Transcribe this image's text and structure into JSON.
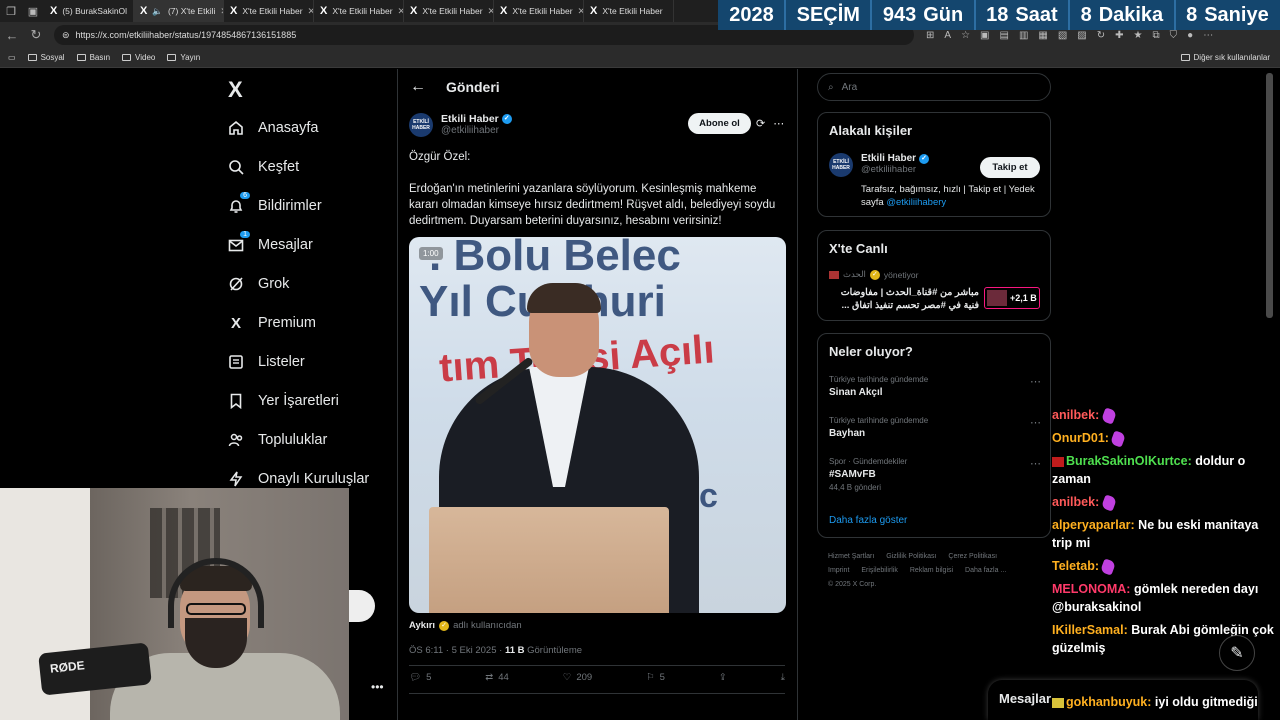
{
  "browser": {
    "tabs": [
      {
        "label": "",
        "active": false
      },
      {
        "label": "(5) BurakSakinOl",
        "active": false
      },
      {
        "label": "(7) X'te Etkili",
        "active": true
      },
      {
        "label": "X'te Etkili Haber",
        "active": false
      },
      {
        "label": "X'te Etkili Haber",
        "active": false
      },
      {
        "label": "X'te Etkili Haber",
        "active": false
      },
      {
        "label": "X'te Etkili Haber",
        "active": false
      },
      {
        "label": "X'te Etkili Haber",
        "active": false
      }
    ],
    "url": "https://x.com/etkiliihaber/status/1974854867136151885",
    "bookmarks": [
      "Sosyal",
      "Basın",
      "Video",
      "Yayın"
    ],
    "other_bookmarks": "Diğer sık kullanılanlar"
  },
  "countdown": {
    "year": "2028",
    "event": "SEÇİM",
    "days_value": "943",
    "days_label": "Gün",
    "hours_value": "18",
    "hours_label": "Saat",
    "minutes_value": "8",
    "minutes_label": "Dakika",
    "seconds_value": "8",
    "seconds_label": "Saniye"
  },
  "nav": {
    "logo": "X",
    "items": [
      {
        "label": "Anasayfa",
        "icon": "home-icon"
      },
      {
        "label": "Keşfet",
        "icon": "search-icon"
      },
      {
        "label": "Bildirimler",
        "icon": "bell-icon",
        "badge": "6"
      },
      {
        "label": "Mesajlar",
        "icon": "mail-icon",
        "badge": "1"
      },
      {
        "label": "Grok",
        "icon": "grok-icon"
      },
      {
        "label": "Premium",
        "icon": "x-icon"
      },
      {
        "label": "Listeler",
        "icon": "list-icon"
      },
      {
        "label": "Yer İşaretleri",
        "icon": "bookmark-icon"
      },
      {
        "label": "Topluluklar",
        "icon": "people-icon"
      },
      {
        "label": "Onaylı Kuruluşlar",
        "icon": "bolt-icon"
      }
    ]
  },
  "post": {
    "header_title": "Gönderi",
    "author_name": "Etkili Haber",
    "author_handle": "@etkiliihaber",
    "avatar_text": "ETKİLİ HABER",
    "subscribe_label": "Abone ol",
    "text_line1": "Özgür Özel:",
    "text_line2": "Erdoğan'ın metinlerini yazanlara söylüyorum. Kesinleşmiş mahkeme kararı olmadan kimseye hırsız dedirtmem! Rüşvet aldı, belediyeyi soydu dedirtmem. Duyarsam beterini duyarsınız, hesabını verirsiniz!",
    "video_time": "1:00",
    "attribution_name": "Aykırı",
    "attribution_suffix": "adlı kullanıcıdan",
    "time": "ÖS 6:11 · 5 Eki 2025 ·",
    "views_value": "11 B",
    "views_label": "Görüntüleme",
    "actions": {
      "replies": "5",
      "reposts": "44",
      "likes": "209",
      "bookmarks": "5"
    }
  },
  "sidebar": {
    "search_placeholder": "Ara",
    "related_title": "Alakalı kişiler",
    "related": {
      "name": "Etkili Haber",
      "handle": "@etkiliihaber",
      "follow_label": "Takip et",
      "bio": "Tarafsız, bağımsız, hızlı | Takip et | Yedek sayfa",
      "bio_link": "@etkiliihabery"
    },
    "live_title": "X'te Canlı",
    "live": {
      "host": "الحدث",
      "host_suffix": "yönetiyor",
      "title": "مباشر من #قناة_الحدث | مفاوضات فنية في #مصر تحسم تنفيذ اتفاق ...",
      "count": "+2,1 B"
    },
    "trends_title": "Neler oluyor?",
    "trends": [
      {
        "context": "Türkiye tarihinde gündemde",
        "topic": "Sinan Akçıl",
        "count": ""
      },
      {
        "context": "Türkiye tarihinde gündemde",
        "topic": "Bayhan",
        "count": ""
      },
      {
        "context": "Spor · Gündemdekiler",
        "topic": "#SAMvFB",
        "count": "44,4 B gönderi"
      }
    ],
    "show_more": "Daha fazla göster",
    "footer": [
      "Hizmet Şartları",
      "Gizlilik Politikası",
      "Çerez Politikası",
      "Imprint",
      "Erişilebilirlik",
      "Reklam bilgisi",
      "Daha fazla ...",
      "© 2025 X Corp."
    ]
  },
  "chat": [
    {
      "user": "anilbek:",
      "color": "#ff5a5a",
      "text": "",
      "emote": true
    },
    {
      "user": "OnurD01:",
      "color": "#ffb020",
      "text": "",
      "emote": true
    },
    {
      "user": "BurakSakinOlKurtce:",
      "color": "#4fe04f",
      "text": "doldur o zaman",
      "badge": true
    },
    {
      "user": "anilbek:",
      "color": "#ff5a5a",
      "text": "",
      "emote": true
    },
    {
      "user": "alperyaparlar:",
      "color": "#ffb020",
      "text": "Ne bu eski manitaya trip mi"
    },
    {
      "user": "Teletab:",
      "color": "#ffb020",
      "text": "",
      "emote": true
    },
    {
      "user": "MELONOMA:",
      "color": "#ff3a6a",
      "text": "gömlek nereden dayı @buraksakinol"
    },
    {
      "user": "IKillerSamal:",
      "color": "#ffb020",
      "text": "Burak Abi gömleğin çok güzelmiş"
    },
    {
      "user": "gokhanbuyuk:",
      "color": "#ffb020",
      "text": "iyi oldu gitmediği",
      "badge": true
    }
  ],
  "messages_drawer": "Mesajlar",
  "webcam": {
    "mic_brand": "RØDE"
  }
}
